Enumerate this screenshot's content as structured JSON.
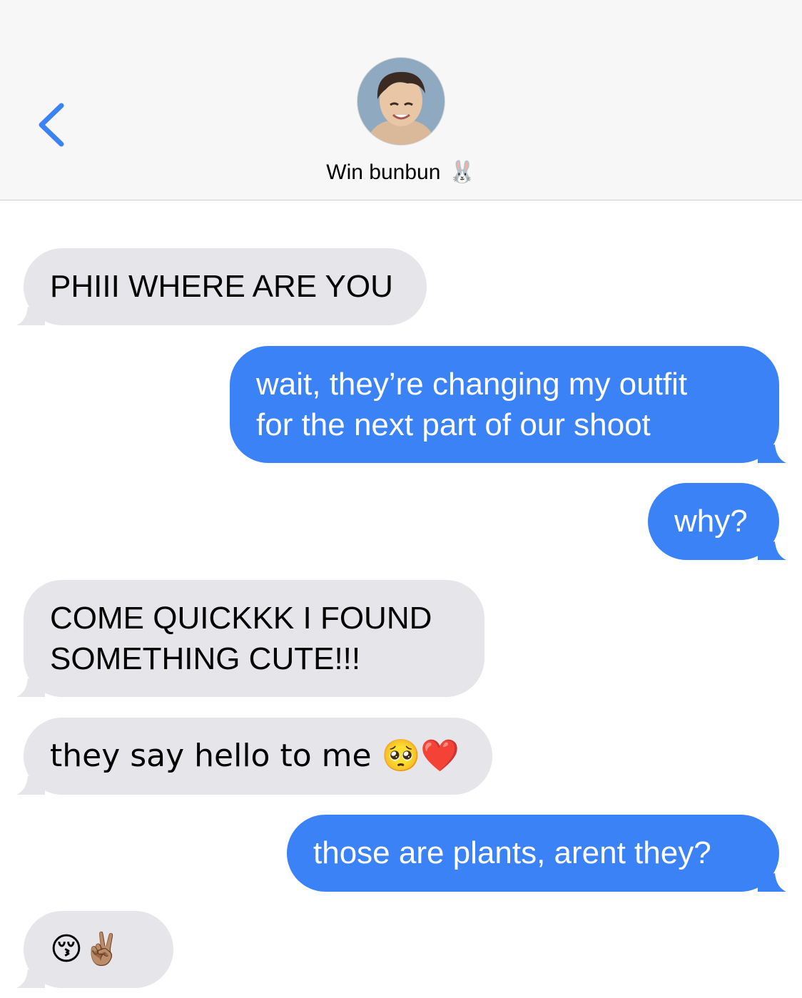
{
  "header": {
    "contact_name": "Win bunbun",
    "contact_emoji": "🐰"
  },
  "colors": {
    "accent": "#3b82f6",
    "incoming_bubble": "#e5e5ea",
    "header_bg": "#f7f7f7"
  },
  "messages": [
    {
      "direction": "incoming",
      "text": "PHIII WHERE ARE YOU"
    },
    {
      "direction": "outgoing",
      "text": "wait, they’re changing my outfit\nfor the next part of our shoot"
    },
    {
      "direction": "outgoing",
      "text": "why?"
    },
    {
      "direction": "incoming",
      "text": "COME QUICKKK I FOUND\nSOMETHING CUTE!!!"
    },
    {
      "direction": "incoming",
      "text": "they say hello to me 🥺❤️"
    },
    {
      "direction": "outgoing",
      "text": "those are plants, arent they?"
    },
    {
      "direction": "incoming",
      "text": "😚✌🏽"
    }
  ]
}
